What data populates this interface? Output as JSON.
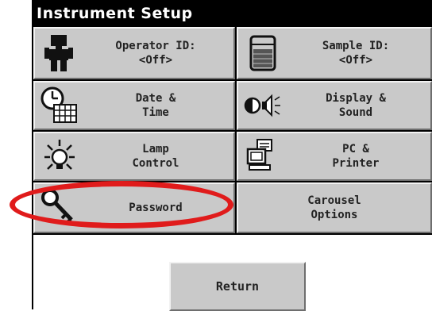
{
  "window": {
    "title": "Instrument Setup"
  },
  "buttons": [
    {
      "id": "operator-id",
      "line1": "Operator ID:",
      "line2": "<Off>",
      "icon": "operator-icon"
    },
    {
      "id": "sample-id",
      "line1": "Sample ID:",
      "line2": "<Off>",
      "icon": "sample-beaker-icon"
    },
    {
      "id": "date-time",
      "line1": "Date &",
      "line2": "Time",
      "icon": "clock-calendar-icon"
    },
    {
      "id": "display-sound",
      "line1": "Display &",
      "line2": "Sound",
      "icon": "contrast-speaker-icon"
    },
    {
      "id": "lamp-control",
      "line1": "Lamp",
      "line2": "Control",
      "icon": "lamp-icon"
    },
    {
      "id": "pc-printer",
      "line1": "PC &",
      "line2": "Printer",
      "icon": "pc-printer-icon"
    },
    {
      "id": "password",
      "line1": "Password",
      "line2": "",
      "icon": "key-icon"
    },
    {
      "id": "carousel-options",
      "line1": "Carousel",
      "line2": "Options",
      "icon": ""
    }
  ],
  "footer": {
    "return_label": "Return"
  },
  "annotation": {
    "highlight_target": "password",
    "highlight_color": "#e01b1b"
  }
}
